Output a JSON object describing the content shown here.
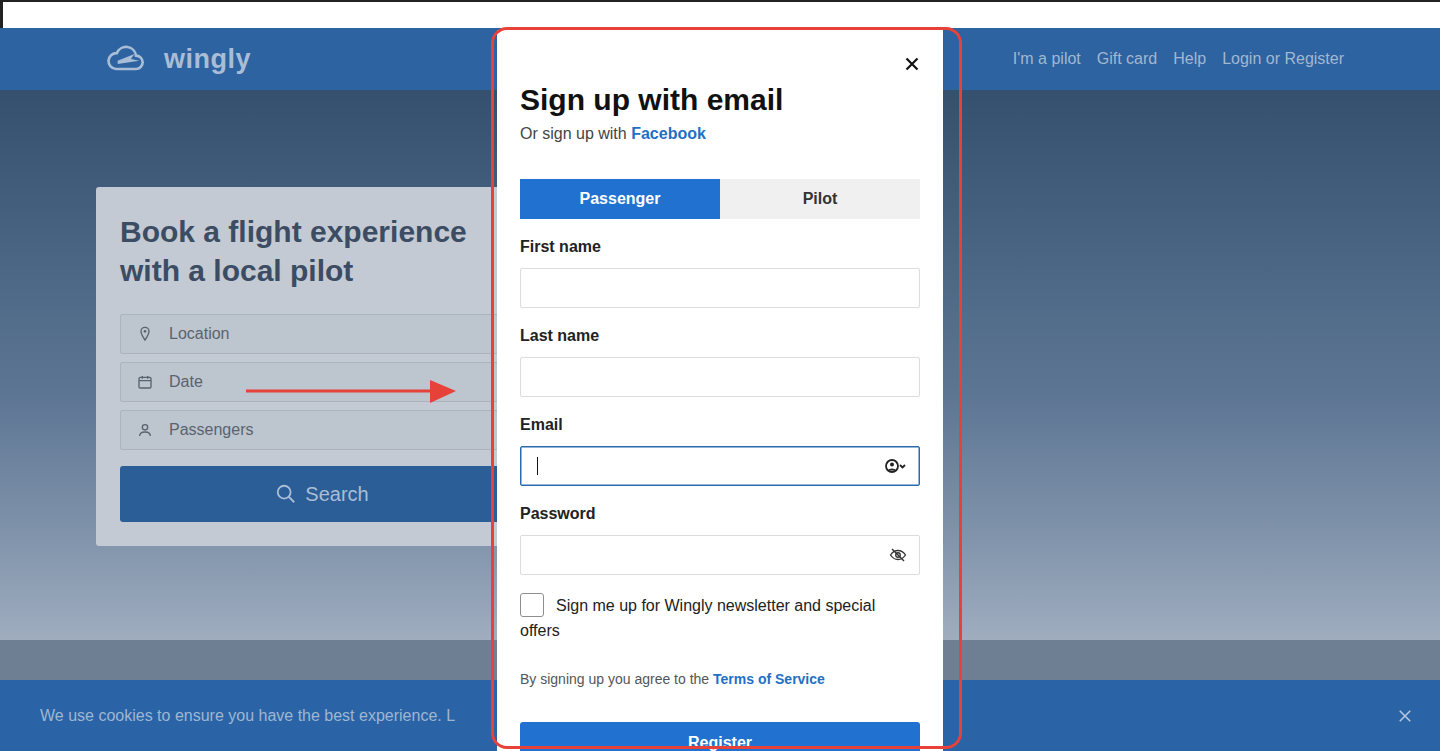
{
  "header": {
    "logo": "wingly",
    "nav": [
      "I'm a pilot",
      "Gift card",
      "Help",
      "Login or Register"
    ]
  },
  "search_card": {
    "title": "Book a flight experience with a local pilot",
    "fields": [
      {
        "placeholder": "Location",
        "kind": "location"
      },
      {
        "placeholder": "Date",
        "kind": "date"
      },
      {
        "placeholder": "Passengers",
        "kind": "passengers"
      }
    ],
    "button": "Search"
  },
  "cookie_bar": {
    "text": "We use cookies to ensure you have the best experience. L"
  },
  "modal": {
    "title": "Sign up with email",
    "subtitle": "Or sign up with ",
    "subtitle_link": "Facebook",
    "tabs": [
      {
        "label": "Passenger",
        "selected": true
      },
      {
        "label": "Pilot",
        "selected": false
      }
    ],
    "fields": [
      {
        "label": "First name",
        "kind": "text",
        "focused": false
      },
      {
        "label": "Last name",
        "kind": "text",
        "focused": false
      },
      {
        "label": "Email",
        "kind": "email",
        "focused": true
      },
      {
        "label": "Password",
        "kind": "password",
        "focused": false
      }
    ],
    "newsletter": {
      "label": "Sign me up for Wingly newsletter and special offers",
      "checked": false
    },
    "terms": {
      "text": "By signing up you agree to the ",
      "link": "Terms of Service"
    },
    "register": "Register"
  }
}
